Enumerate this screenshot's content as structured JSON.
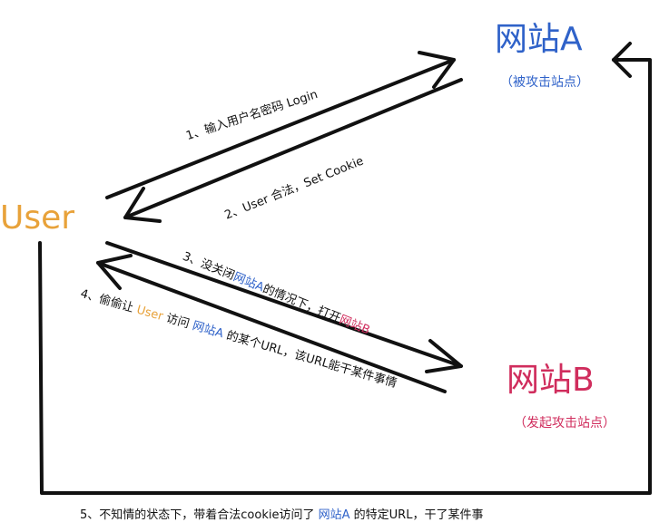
{
  "nodes": {
    "site_a": {
      "label": "网站A",
      "sub": "（被攻击站点）"
    },
    "user": {
      "label": "User"
    },
    "site_b": {
      "label": "网站B",
      "sub": "（发起攻击站点）"
    }
  },
  "steps": {
    "s1": "1、输入用户名密码 Login",
    "s2": "2、User 合法，Set Cookie",
    "s3": {
      "pre": "3、没关闭",
      "site_a": "网站A",
      "mid": "的情况下，打开",
      "site_b": "网站B"
    },
    "s4": {
      "pre": "4、偷偷让 ",
      "user": "User",
      "mid1": " 访问 ",
      "site_a": "网站A",
      "post": " 的某个URL，该URL能干某件事情"
    },
    "s5": {
      "pre": "5、不知情的状态下，带着合法cookie访问了 ",
      "site_a": "网站A",
      "post": " 的特定URL，干了某件事"
    }
  },
  "colors": {
    "site_a": "#2f62c9",
    "user": "#e8a23a",
    "site_b": "#d02d5d",
    "ink": "#111111"
  }
}
